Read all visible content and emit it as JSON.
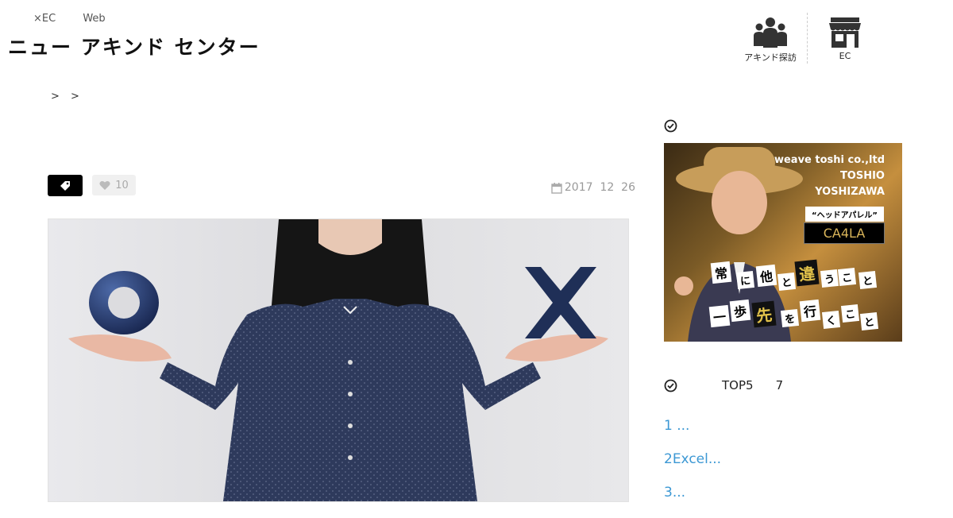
{
  "topnav": {
    "item1": "×EC",
    "item2": "Web"
  },
  "logo": "ニュー アキンド センター",
  "header_icons": {
    "people_label": "アキンド探訪",
    "shop_label": "EC"
  },
  "breadcrumb": {
    "sep1": ">",
    "sep2": ">"
  },
  "article_meta": {
    "likes": "10",
    "date_year": "2017",
    "date_month": "12",
    "date_day": "26"
  },
  "sidebar": {
    "banner": {
      "company": "weave toshi co.,ltd",
      "name_first": "TOSHIO",
      "name_last": "YOSHIZAWA",
      "tagline": "“ヘッドアパレル”",
      "brand": "CA4LA",
      "chips": [
        "常",
        "に",
        "他",
        "と",
        "違",
        "う",
        "こ",
        "と",
        "一",
        "歩",
        "先",
        "を",
        "行",
        "く",
        "こ",
        "と"
      ]
    },
    "ranking": {
      "title": "TOP5",
      "count": "7",
      "items": [
        "1 ...",
        "2Excel...",
        "3..."
      ]
    }
  },
  "colors": {
    "link": "#3c98d4",
    "shirt": "#2e3a5c",
    "symbol": "#1f2f57"
  }
}
